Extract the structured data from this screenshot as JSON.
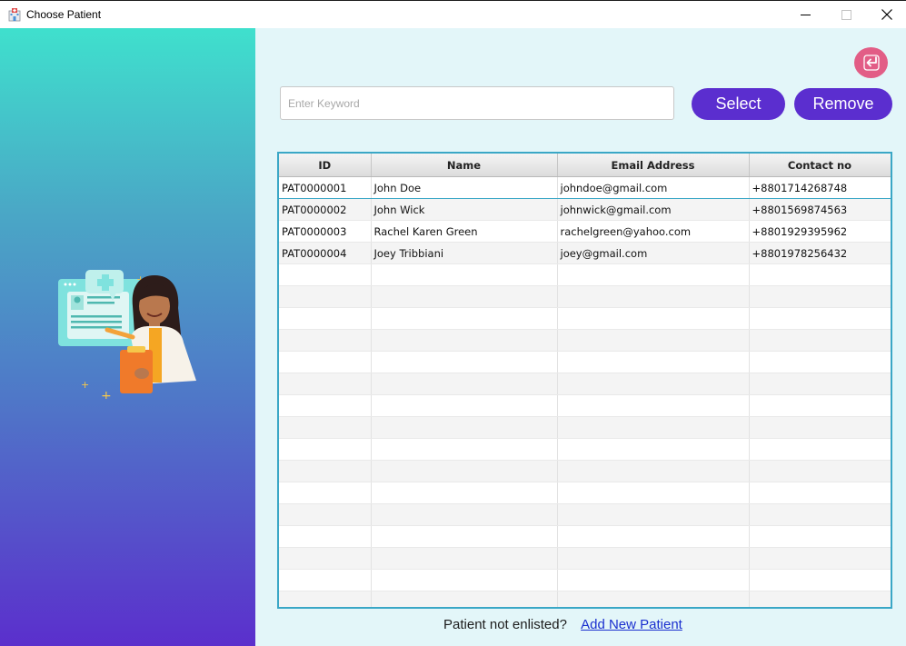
{
  "window": {
    "title": "Choose Patient",
    "icon": "hospital-icon"
  },
  "search": {
    "placeholder": "Enter Keyword",
    "value": ""
  },
  "buttons": {
    "select": "Select",
    "remove": "Remove",
    "back_icon": "return-arrow-icon"
  },
  "table": {
    "columns": [
      "ID",
      "Name",
      "Email Address",
      "Contact no"
    ],
    "rows": [
      [
        "PAT0000001",
        "John Doe",
        "johndoe@gmail.com",
        "+8801714268748"
      ],
      [
        "PAT0000002",
        "John Wick",
        "johnwick@gmail.com",
        "+8801569874563"
      ],
      [
        "PAT0000003",
        "Rachel Karen Green",
        "rachelgreen@yahoo.com",
        "+8801929395962"
      ],
      [
        "PAT0000004",
        "Joey Tribbiani",
        "joey@gmail.com",
        "+8801978256432"
      ]
    ]
  },
  "footer": {
    "prompt": "Patient not enlisted?",
    "link": "Add New Patient"
  },
  "colors": {
    "accent": "#5b2ecf",
    "back_button": "#e25d86",
    "table_border": "#3aa7c6",
    "background": "#e3f6f9"
  }
}
